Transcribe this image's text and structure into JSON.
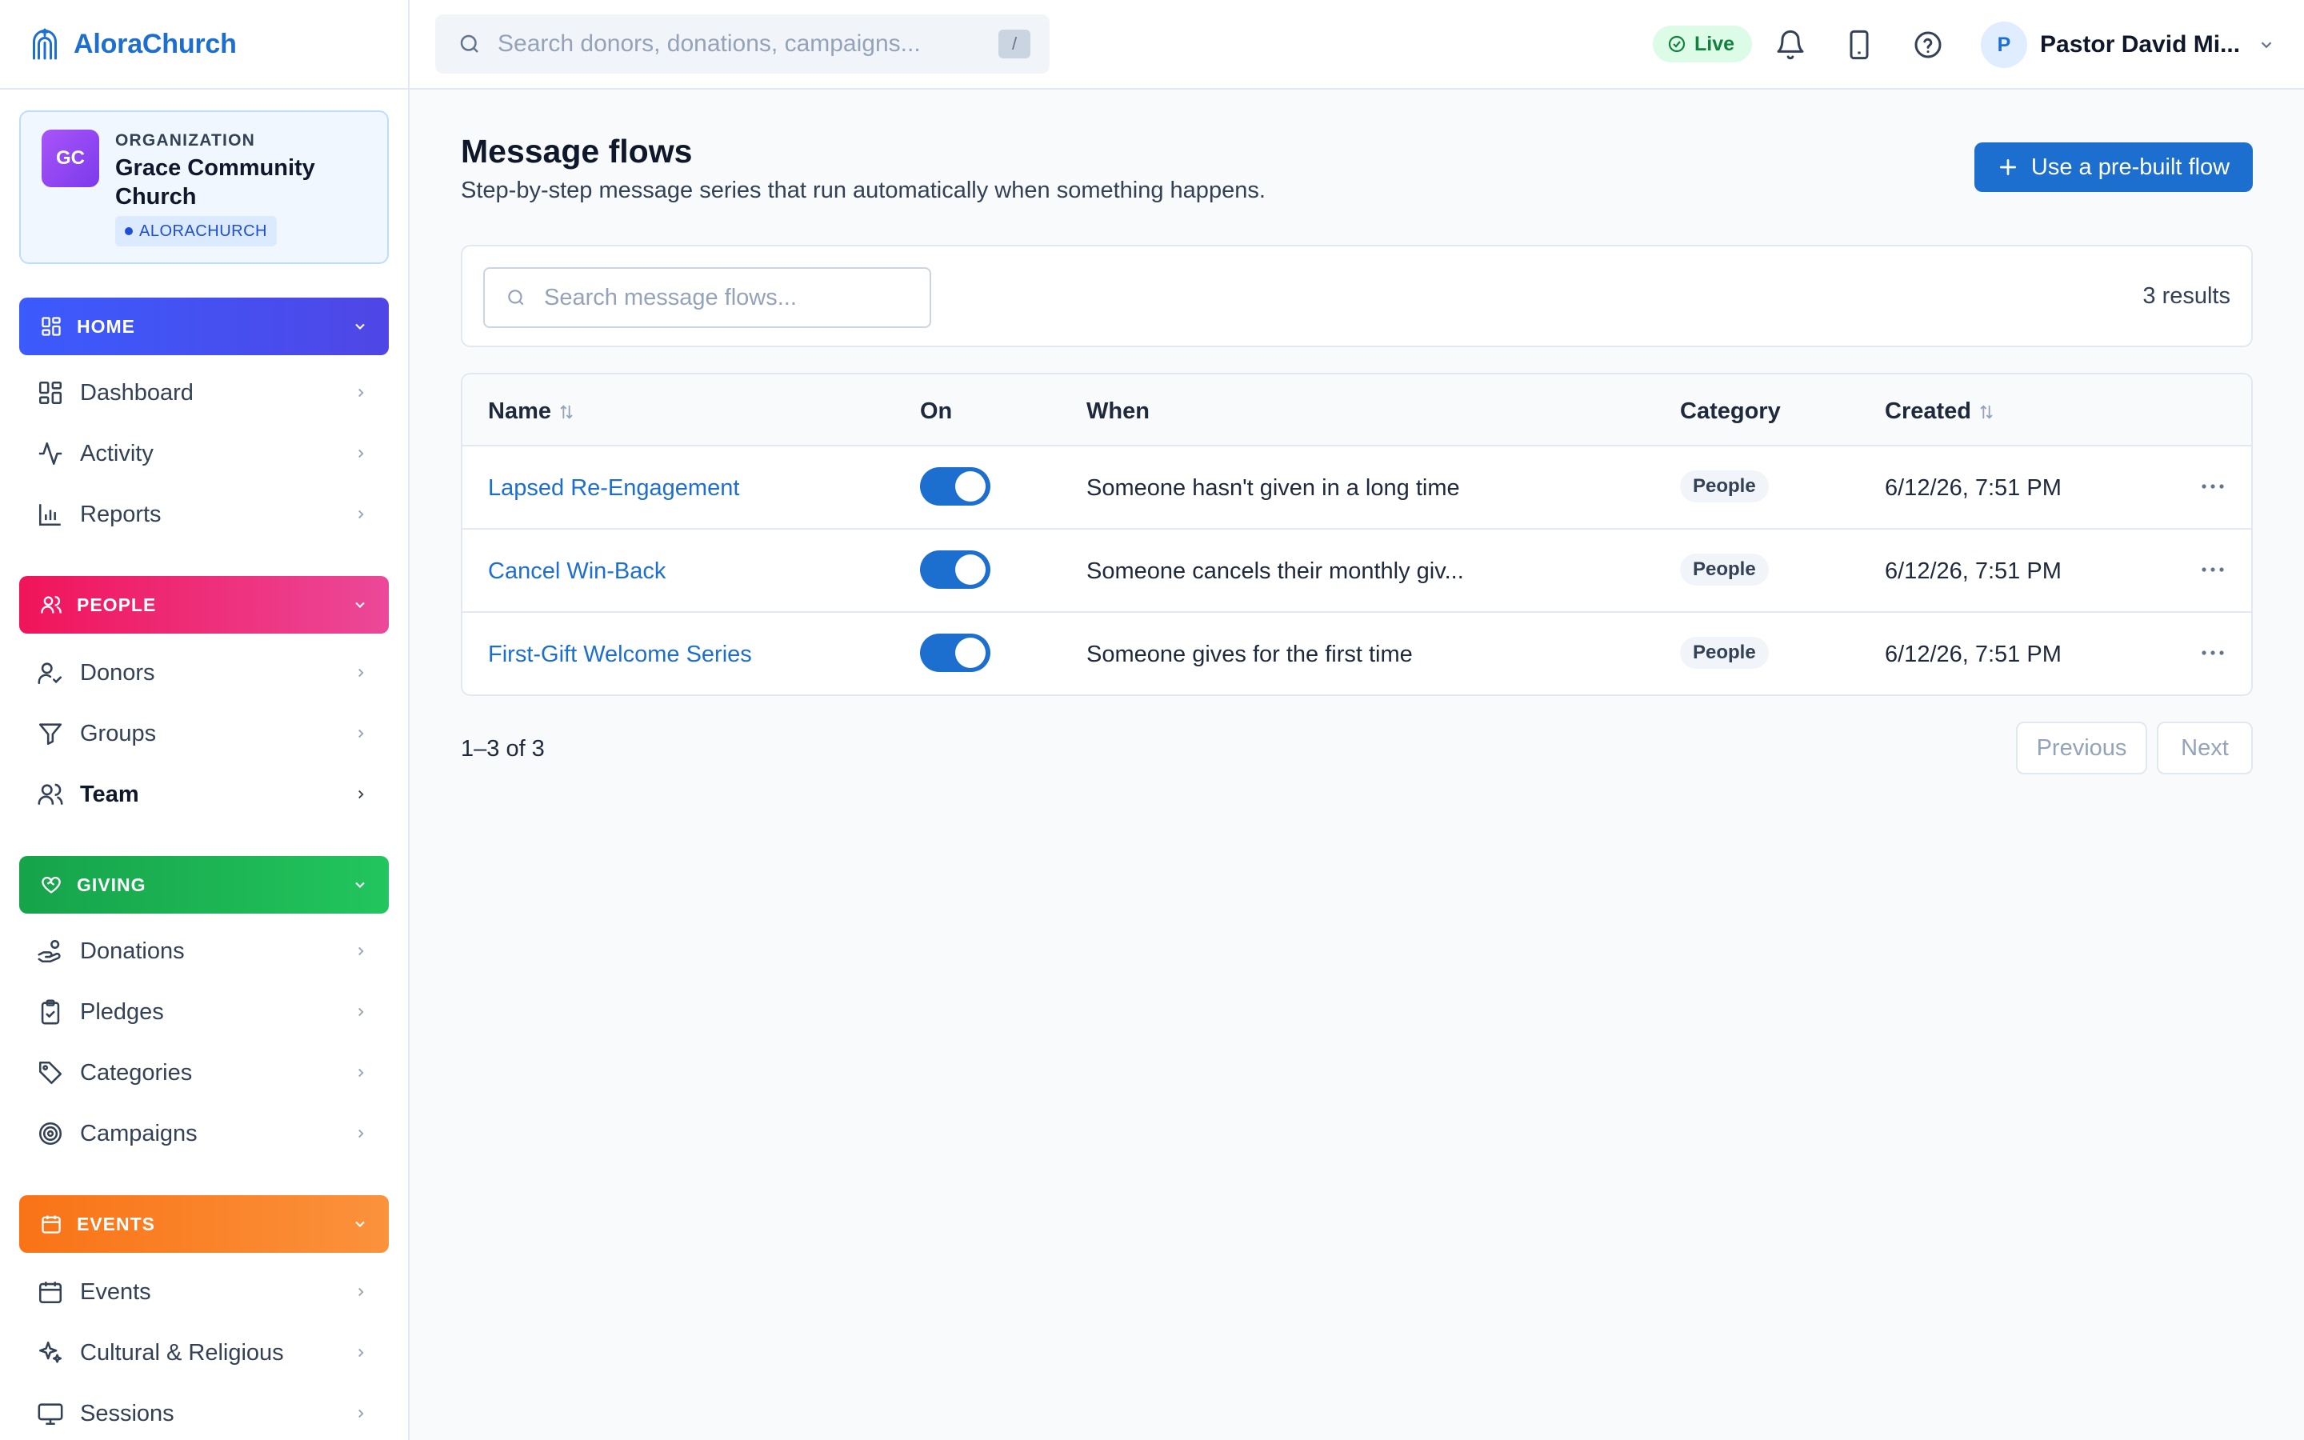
{
  "brand": {
    "name": "AloraChurch"
  },
  "org": {
    "initials": "GC",
    "label": "ORGANIZATION",
    "name": "Grace Community Church",
    "tag": "ALORACHURCH"
  },
  "sidebar": {
    "home": {
      "label": "HOME",
      "items": [
        {
          "label": "Dashboard",
          "icon": "dashboard-icon"
        },
        {
          "label": "Activity",
          "icon": "activity-icon"
        },
        {
          "label": "Reports",
          "icon": "bar-chart-icon"
        }
      ]
    },
    "people": {
      "label": "PEOPLE",
      "items": [
        {
          "label": "Donors",
          "icon": "user-check-icon"
        },
        {
          "label": "Groups",
          "icon": "filter-icon"
        },
        {
          "label": "Team",
          "icon": "users-icon",
          "active": true
        }
      ]
    },
    "giving": {
      "label": "GIVING",
      "items": [
        {
          "label": "Donations",
          "icon": "hand-coins-icon"
        },
        {
          "label": "Pledges",
          "icon": "clipboard-check-icon"
        },
        {
          "label": "Categories",
          "icon": "tag-icon"
        },
        {
          "label": "Campaigns",
          "icon": "target-icon"
        }
      ]
    },
    "events": {
      "label": "EVENTS",
      "items": [
        {
          "label": "Events",
          "icon": "calendar-icon"
        },
        {
          "label": "Cultural & Religious",
          "icon": "sparkles-icon"
        },
        {
          "label": "Sessions",
          "icon": "monitor-icon"
        }
      ]
    }
  },
  "topbar": {
    "search_placeholder": "Search donors, donations, campaigns...",
    "shortcut": "/",
    "live_label": "Live",
    "user_initial": "P",
    "user_name": "Pastor David Mi..."
  },
  "page": {
    "title": "Message flows",
    "subtitle": "Step-by-step message series that run automatically when something happens.",
    "primary_action": "Use a pre-built flow",
    "search_placeholder": "Search message flows...",
    "results": "3 results"
  },
  "table": {
    "columns": {
      "name": "Name",
      "on": "On",
      "when": "When",
      "category": "Category",
      "created": "Created"
    },
    "rows": [
      {
        "name": "Lapsed Re-Engagement",
        "on": true,
        "when": "Someone hasn't given in a long time",
        "category": "People",
        "created": "6/12/26, 7:51 PM"
      },
      {
        "name": "Cancel Win-Back",
        "on": true,
        "when": "Someone cancels their monthly giv...",
        "category": "People",
        "created": "6/12/26, 7:51 PM"
      },
      {
        "name": "First-Gift Welcome Series",
        "on": true,
        "when": "Someone gives for the first time",
        "category": "People",
        "created": "6/12/26, 7:51 PM"
      }
    ]
  },
  "pagination": {
    "info": "1–3 of 3",
    "previous": "Previous",
    "next": "Next"
  },
  "colors": {
    "accent": "#1d6fcf",
    "home": "#3b5bfd",
    "people": "#f0145a",
    "giving": "#16a34a",
    "events": "#f97316"
  }
}
